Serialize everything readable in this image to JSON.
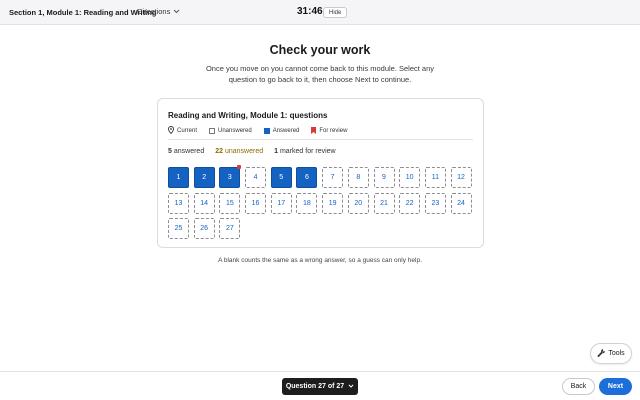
{
  "header": {
    "section_title": "Section 1, Module 1: Reading and Writing",
    "directions_label": "Directions",
    "timer": "31:46",
    "hide_label": "Hide"
  },
  "main": {
    "heading": "Check your work",
    "instructions": "Once you move on you cannot come back to this module. Select any question to go back to it, then choose Next to continue.",
    "card_title": "Reading and Writing, Module 1: questions",
    "legend": {
      "current": "Current",
      "unanswered": "Unanswered",
      "answered": "Answered",
      "review": "For review"
    },
    "stats": {
      "answered_count": "5",
      "answered_label": "answered",
      "unanswered_count": "22",
      "unanswered_label": "unanswered",
      "review_count": "1",
      "review_label": "marked for review"
    },
    "questions": [
      {
        "n": "1",
        "answered": true,
        "flagged": false
      },
      {
        "n": "2",
        "answered": true,
        "flagged": false
      },
      {
        "n": "3",
        "answered": true,
        "flagged": true
      },
      {
        "n": "4",
        "answered": false,
        "flagged": false
      },
      {
        "n": "5",
        "answered": true,
        "flagged": false
      },
      {
        "n": "6",
        "answered": true,
        "flagged": false
      },
      {
        "n": "7",
        "answered": false,
        "flagged": false
      },
      {
        "n": "8",
        "answered": false,
        "flagged": false
      },
      {
        "n": "9",
        "answered": false,
        "flagged": false
      },
      {
        "n": "10",
        "answered": false,
        "flagged": false
      },
      {
        "n": "11",
        "answered": false,
        "flagged": false
      },
      {
        "n": "12",
        "answered": false,
        "flagged": false
      },
      {
        "n": "13",
        "answered": false,
        "flagged": false
      },
      {
        "n": "14",
        "answered": false,
        "flagged": false
      },
      {
        "n": "15",
        "answered": false,
        "flagged": false
      },
      {
        "n": "16",
        "answered": false,
        "flagged": false
      },
      {
        "n": "17",
        "answered": false,
        "flagged": false
      },
      {
        "n": "18",
        "answered": false,
        "flagged": false
      },
      {
        "n": "19",
        "answered": false,
        "flagged": false
      },
      {
        "n": "20",
        "answered": false,
        "flagged": false
      },
      {
        "n": "21",
        "answered": false,
        "flagged": false
      },
      {
        "n": "22",
        "answered": false,
        "flagged": false
      },
      {
        "n": "23",
        "answered": false,
        "flagged": false
      },
      {
        "n": "24",
        "answered": false,
        "flagged": false
      },
      {
        "n": "25",
        "answered": false,
        "flagged": false
      },
      {
        "n": "26",
        "answered": false,
        "flagged": false
      },
      {
        "n": "27",
        "answered": false,
        "flagged": false
      }
    ],
    "note": "A blank counts the same as a wrong answer, so a guess can only help."
  },
  "tools": {
    "label": "Tools",
    "icon": "wrench-icon"
  },
  "footer": {
    "question_nav": "Question 27 of 27",
    "back_label": "Back",
    "next_label": "Next"
  },
  "colors": {
    "answered": "#1463c2",
    "review_flag": "#d83a3a",
    "next_button": "#1c6fd9",
    "nav_pill": "#1d1d1d"
  }
}
